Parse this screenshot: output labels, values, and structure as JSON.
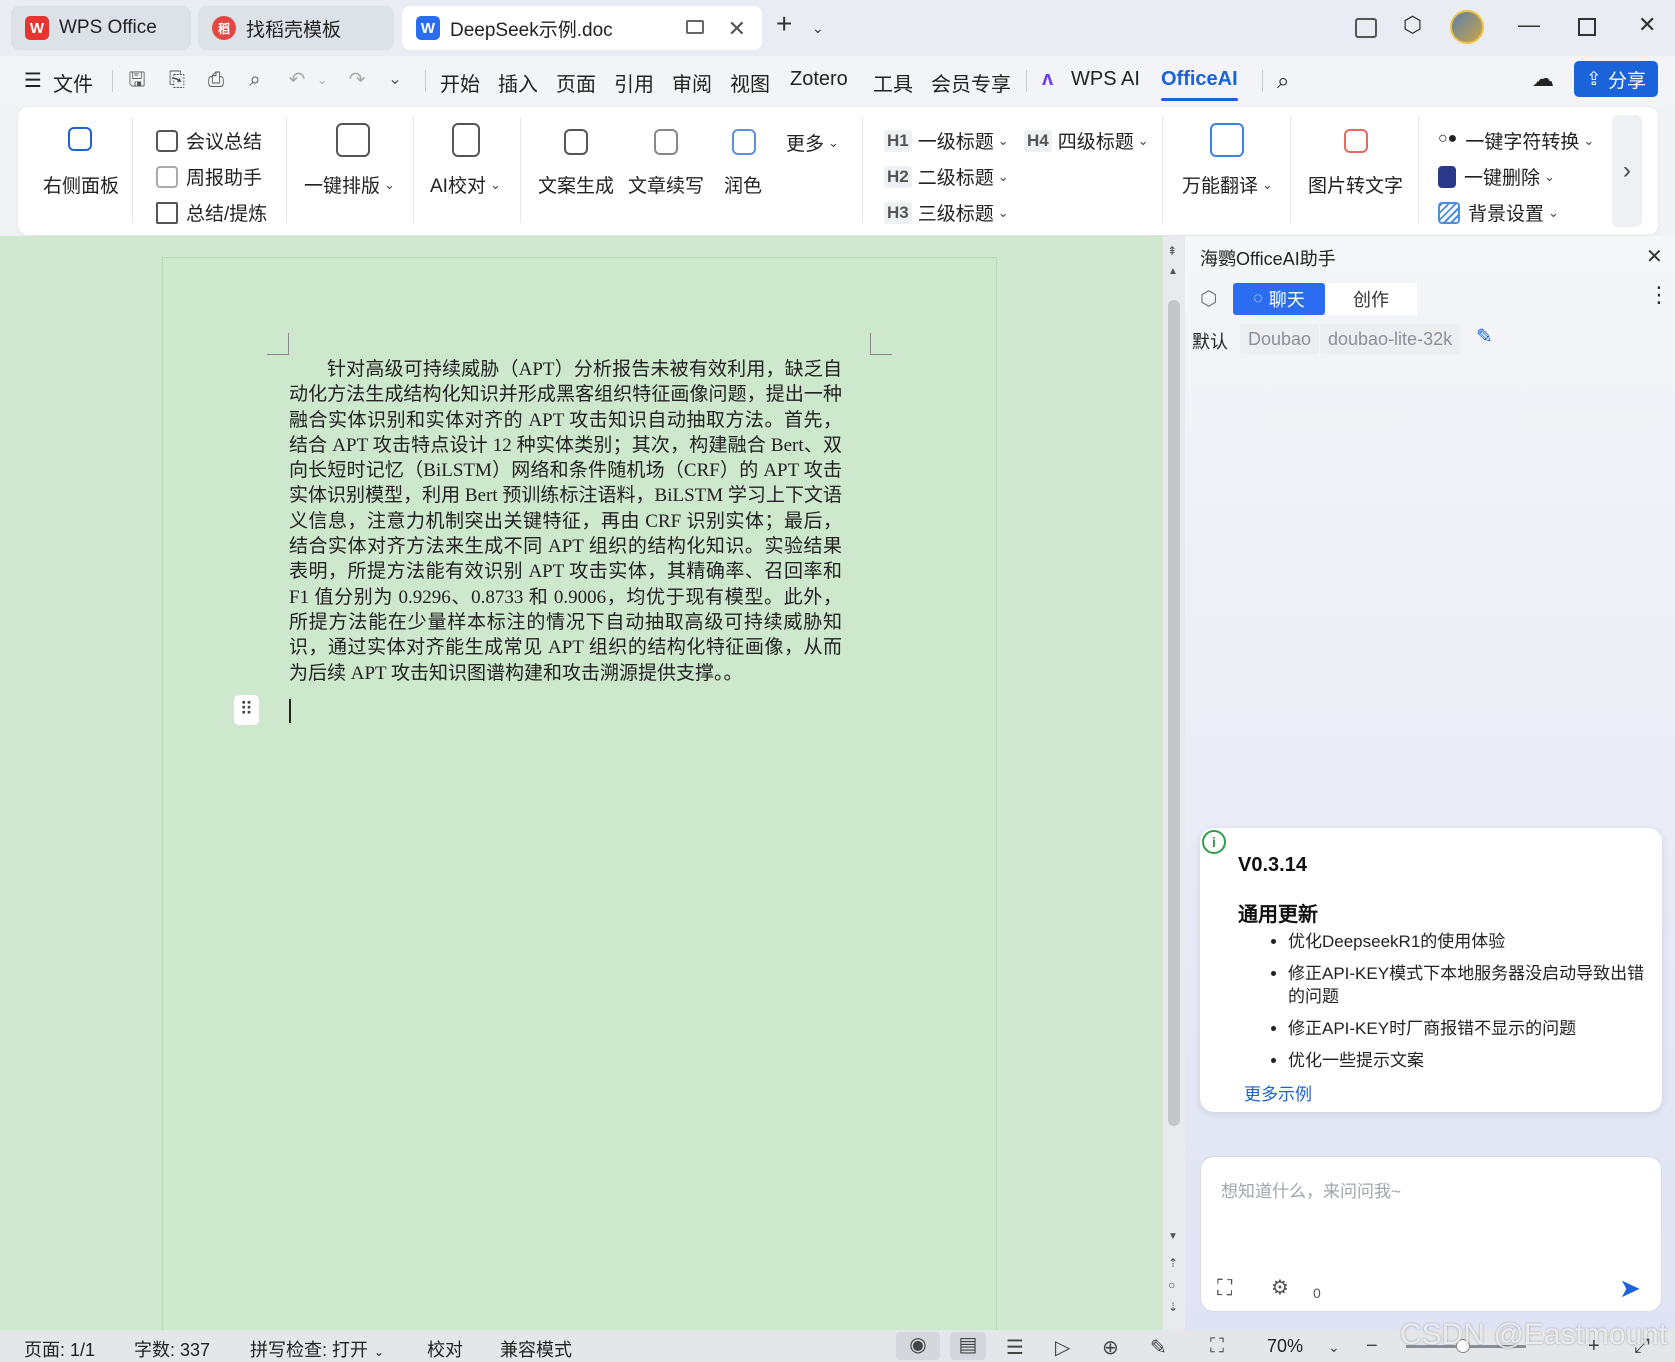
{
  "tabs": [
    {
      "label": "WPS Office",
      "logo": "W"
    },
    {
      "label": "找稻壳模板",
      "logo": "稻"
    },
    {
      "label": "DeepSeek示例.doc",
      "logo": "W"
    }
  ],
  "menu": {
    "file": "文件",
    "items": [
      "开始",
      "插入",
      "页面",
      "引用",
      "审阅",
      "视图",
      "Zotero",
      "工具",
      "会员专享"
    ],
    "wps_ai": "WPS AI",
    "officeai": "OfficeAI",
    "share": "分享"
  },
  "ribbon": {
    "right_panel": "右侧面板",
    "meeting_summary": "会议总结",
    "weekly_report": "周报助手",
    "summary_extract": "总结/提炼",
    "one_click_format": "一键排版",
    "ai_proofread": "AI校对",
    "copy_gen": "文案生成",
    "continue_write": "文章续写",
    "polish": "润色",
    "more": "更多",
    "h1": "H1",
    "h1_label": "一级标题",
    "h2": "H2",
    "h2_label": "二级标题",
    "h3": "H3",
    "h3_label": "三级标题",
    "h4": "H4",
    "h4_label": "四级标题",
    "translate": "万能翻译",
    "img_to_text": "图片转文字",
    "char_convert": "一键字符转换",
    "one_click_delete": "一键删除",
    "bg_settings": "背景设置"
  },
  "document": {
    "paragraph": "针对高级可持续威胁（APT）分析报告未被有效利用，缺乏自动化方法生成结构化知识并形成黑客组织特征画像问题，提出一种融合实体识别和实体对齐的 APT 攻击知识自动抽取方法。首先，结合 APT 攻击特点设计 12 种实体类别；其次，构建融合 Bert、双向长短时记忆（BiLSTM）网络和条件随机场（CRF）的 APT 攻击实体识别模型，利用 Bert 预训练标注语料，BiLSTM 学习上下文语义信息，注意力机制突出关键特征，再由 CRF 识别实体；最后，结合实体对齐方法来生成不同 APT 组织的结构化知识。实验结果表明，所提方法能有效识别 APT 攻击实体，其精确率、召回率和 F1 值分别为 0.9296、0.8733 和 0.9006，均优于现有模型。此外，所提方法能在少量样本标注的情况下自动抽取高级可持续威胁知识，通过实体对齐能生成常见 APT 组织的结构化特征画像，从而为后续 APT 攻击知识图谱构建和攻击溯源提供支撑。。"
  },
  "panel": {
    "title": "海鹦OfficeAI助手",
    "tab_chat": "聊天",
    "tab_create": "创作",
    "default_label": "默认",
    "provider": "Doubao",
    "model": "doubao-lite-32k",
    "card": {
      "version": "V0.3.14",
      "section": "通用更新",
      "items": [
        "优化DeepseekR1的使用体验",
        "修正API-KEY模式下本地服务器没启动导致出错的问题",
        "修正API-KEY时厂商报错不显示的问题",
        "优化一些提示文案"
      ],
      "more": "更多示例"
    },
    "input_placeholder": "想知道什么，来问问我~",
    "count": "0"
  },
  "status": {
    "page": "页面: 1/1",
    "words": "字数: 337",
    "spell": "拼写检查: 打开",
    "proof": "校对",
    "compat": "兼容模式",
    "zoom": "70%"
  },
  "watermark": "CSDN @Eastmount",
  "colors": {
    "accent": "#1a63d8",
    "doc_bg": "#cde8cc",
    "wps_red": "#e8352f",
    "send": "#1a63d8"
  }
}
